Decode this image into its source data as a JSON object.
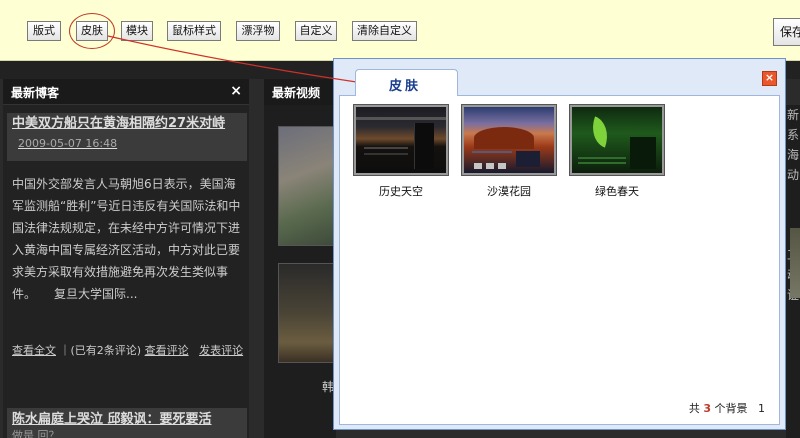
{
  "toolbar": {
    "buttons": [
      "版式",
      "皮肤",
      "模块",
      "鼠标样式",
      "漂浮物",
      "自定义",
      "清除自定义"
    ],
    "save_label": "保存"
  },
  "sidebar": {
    "title": "最新博客",
    "close_glyph": "×",
    "post1_title": "中美双方船只在黄海相隔约27米对峙",
    "post1_date": "2009-05-07 16:48",
    "post1_body": "中国外交部发言人马朝旭6日表示，美国海军监测船“胜利”号近日违反有关国际法和中国法律法规规定，在未经中方许可情况下进入黄海中国专属经济区活动，中方对此已要求美方采取有效措施避免再次发生类似事件。　　复旦大学国际...",
    "read_more": "查看全文",
    "comment_count_text": "(已有2条评论)",
    "view_comments": "查看评论",
    "post_comment": "发表评论",
    "post2_title": "陈水扁庭上哭泣 邱毅讽：要死要活",
    "post2_sub": "做是 回？"
  },
  "video": {
    "title": "最新视频",
    "caption": "韩"
  },
  "right_strip_text": "新\n系\n海\n动\n\n\n\n工\n动\n证",
  "dialog": {
    "tab_label": "皮肤",
    "close_glyph": "×",
    "skins": [
      {
        "name": "历史天空",
        "icon": "skin-history-sky"
      },
      {
        "name": "沙漠花园",
        "icon": "skin-desert-garden"
      },
      {
        "name": "绿色春天",
        "icon": "skin-green-spring"
      }
    ],
    "footer_prefix": "共",
    "footer_count": "3",
    "footer_suffix": "个背景",
    "footer_page": "1"
  },
  "colors": {
    "toolbar_bg": "#ffffd4",
    "page_bg": "#2b2b2b",
    "dialog_frame": "#dfe9f7",
    "accent_red": "#c0392b"
  }
}
